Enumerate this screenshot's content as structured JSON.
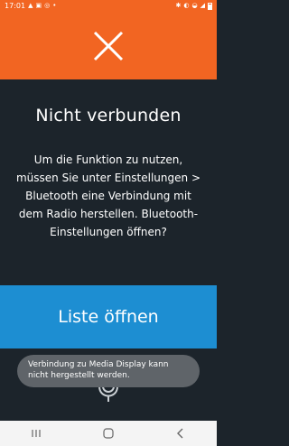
{
  "status_bar": {
    "time": "17:01",
    "left_icons": [
      "navigation-icon",
      "image-icon",
      "sync-icon",
      "dot-icon"
    ],
    "right_icons": [
      "bluetooth-icon",
      "mute-icon",
      "wifi-icon",
      "signal-icon",
      "battery-icon"
    ]
  },
  "header": {
    "color": "#f26522",
    "close_icon": "close-icon"
  },
  "main": {
    "title": "Nicht verbunden",
    "message": "Um die Funktion zu nutzen, müssen Sie unter Einstellungen > Bluetooth eine Verbindung mit dem Radio herstellen. Bluetooth-Einstellungen öffnen?",
    "list_button_label": "Liste öffnen",
    "mic_icon": "microphone-icon"
  },
  "toast": {
    "text": "Verbindung zu Media Display kann nicht hergestellt werden."
  },
  "nav_bar": {
    "icons": [
      "recent-apps-icon",
      "home-icon",
      "back-icon"
    ]
  },
  "colors": {
    "accent": "#f26522",
    "button": "#1d8ed2",
    "background": "#1c242b"
  }
}
